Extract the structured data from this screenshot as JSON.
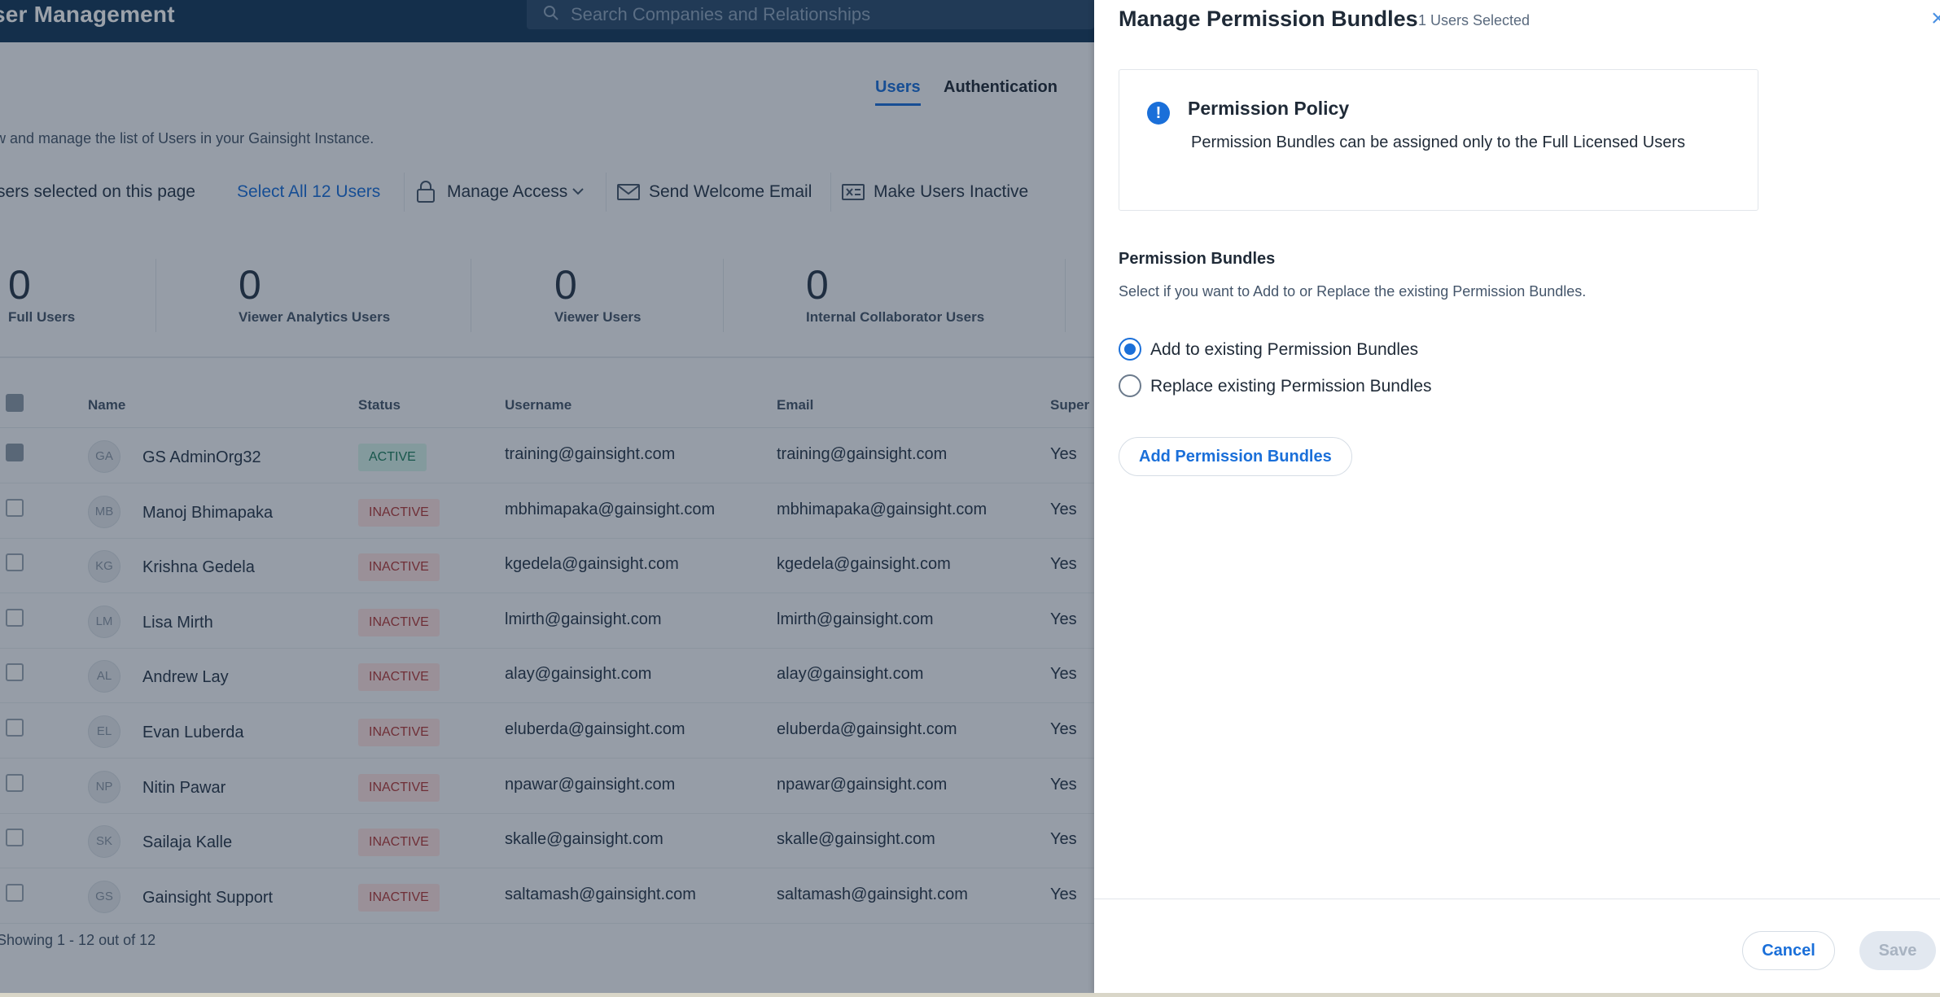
{
  "header": {
    "app_title": "ser Management",
    "search_placeholder": "Search Companies and Relationships"
  },
  "tabs": [
    {
      "label": "Users"
    },
    {
      "label": "Authentication"
    }
  ],
  "description": "w and manage the list of Users in your Gainsight Instance.",
  "actions": {
    "selected_info": "sers selected on this page",
    "select_all": "Select All 12 Users",
    "manage_access": "Manage Access",
    "send_welcome": "Send Welcome Email",
    "make_inactive": "Make Users Inactive"
  },
  "stats": [
    {
      "value": "0",
      "label": "Full Users"
    },
    {
      "value": "0",
      "label": "Viewer Analytics Users"
    },
    {
      "value": "0",
      "label": "Viewer Users"
    },
    {
      "value": "0",
      "label": "Internal Collaborator Users"
    }
  ],
  "table": {
    "columns": [
      "Name",
      "Status",
      "Username",
      "Email",
      "Super"
    ],
    "rows": [
      {
        "initials": "GA",
        "name": "GS AdminOrg32",
        "status": "ACTIVE",
        "username": "training@gainsight.com",
        "email": "training@gainsight.com",
        "super": "Yes",
        "checked": true
      },
      {
        "initials": "MB",
        "name": "Manoj Bhimapaka",
        "status": "INACTIVE",
        "username": "mbhimapaka@gainsight.com",
        "email": "mbhimapaka@gainsight.com",
        "super": "Yes",
        "checked": false
      },
      {
        "initials": "KG",
        "name": "Krishna Gedela",
        "status": "INACTIVE",
        "username": "kgedela@gainsight.com",
        "email": "kgedela@gainsight.com",
        "super": "Yes",
        "checked": false
      },
      {
        "initials": "LM",
        "name": "Lisa Mirth",
        "status": "INACTIVE",
        "username": "lmirth@gainsight.com",
        "email": "lmirth@gainsight.com",
        "super": "Yes",
        "checked": false
      },
      {
        "initials": "AL",
        "name": "Andrew Lay",
        "status": "INACTIVE",
        "username": "alay@gainsight.com",
        "email": "alay@gainsight.com",
        "super": "Yes",
        "checked": false
      },
      {
        "initials": "EL",
        "name": "Evan Luberda",
        "status": "INACTIVE",
        "username": "eluberda@gainsight.com",
        "email": "eluberda@gainsight.com",
        "super": "Yes",
        "checked": false
      },
      {
        "initials": "NP",
        "name": "Nitin Pawar",
        "status": "INACTIVE",
        "username": "npawar@gainsight.com",
        "email": "npawar@gainsight.com",
        "super": "Yes",
        "checked": false
      },
      {
        "initials": "SK",
        "name": "Sailaja Kalle",
        "status": "INACTIVE",
        "username": "skalle@gainsight.com",
        "email": "skalle@gainsight.com",
        "super": "Yes",
        "checked": false
      },
      {
        "initials": "GS",
        "name": "Gainsight Support",
        "status": "INACTIVE",
        "username": "saltamash@gainsight.com",
        "email": "saltamash@gainsight.com",
        "super": "Yes",
        "checked": false
      }
    ],
    "pager": "Showing 1 - 12 out of 12"
  },
  "panel": {
    "title": "Manage Permission Bundles",
    "selected_count": "1 Users Selected",
    "close_icon": "×",
    "policy": {
      "icon": "!",
      "title": "Permission Policy",
      "text": "Permission Bundles can be assigned only to the Full Licensed Users"
    },
    "section_title": "Permission Bundles",
    "section_subtitle": "Select if you want to Add to or Replace the existing Permission Bundles.",
    "options": [
      {
        "label": "Add to existing Permission Bundles",
        "selected": true
      },
      {
        "label": "Replace existing Permission Bundles",
        "selected": false
      }
    ],
    "add_button": "Add Permission Bundles",
    "cancel_button": "Cancel",
    "save_button": "Save"
  },
  "colors": {
    "accent": "#1a6fd9",
    "topbar": "#16395c",
    "active_badge": "#d5f1e9",
    "inactive_badge": "#fbe1e1"
  }
}
